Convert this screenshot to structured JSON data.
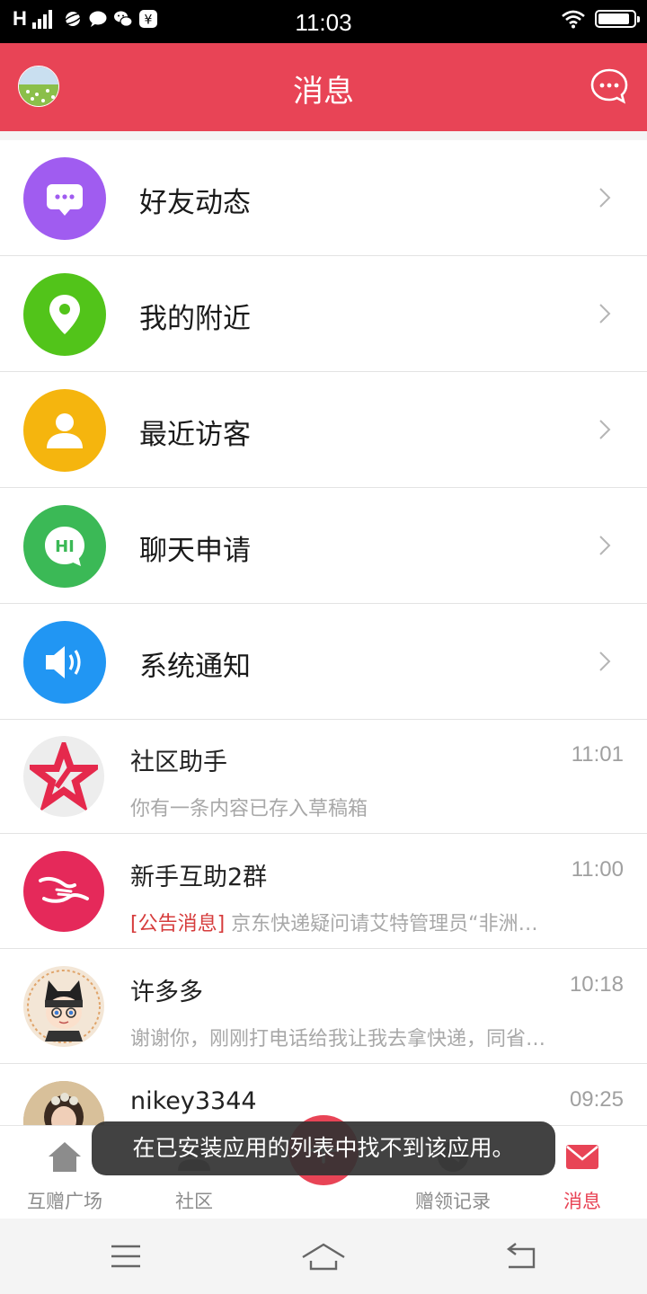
{
  "status_bar": {
    "carrier": "H",
    "time": "11:03"
  },
  "header": {
    "title": "消息"
  },
  "features": [
    {
      "label": "好友动态",
      "icon": "chat-dots-icon",
      "color": "#a05cf0"
    },
    {
      "label": "我的附近",
      "icon": "location-pin-icon",
      "color": "#52c41a"
    },
    {
      "label": "最近访客",
      "icon": "person-icon",
      "color": "#f5b50e"
    },
    {
      "label": "聊天申请",
      "icon": "hi-bubble-icon",
      "color": "#3bb956"
    },
    {
      "label": "系统通知",
      "icon": "speaker-icon",
      "color": "#2196f3"
    }
  ],
  "messages": [
    {
      "name": "社区助手",
      "time": "11:01",
      "tag": "",
      "preview": "你有一条内容已存入草稿箱",
      "avatar": "star-logo-icon"
    },
    {
      "name": "新手互助2群",
      "time": "11:00",
      "tag": "[公告消息]",
      "preview": " 京东快递疑问请艾特管理员“非洲…",
      "avatar": "handshake-icon"
    },
    {
      "name": "许多多",
      "time": "10:18",
      "tag": "",
      "preview": "谢谢你，刚刚打电话给我让我去拿快递，同省…",
      "avatar": "cartoon-girl-avatar"
    },
    {
      "name": "nikey3344",
      "time": "09:25",
      "tag": "",
      "preview": "",
      "avatar": "girl-photo-avatar"
    }
  ],
  "tabs": [
    {
      "label": "互赠广场",
      "icon": "house-icon"
    },
    {
      "label": "社区",
      "icon": "community-icon"
    },
    {
      "label": "",
      "icon": "plus-icon"
    },
    {
      "label": "赠领记录",
      "icon": "record-icon"
    },
    {
      "label": "消息",
      "icon": "envelope-icon"
    }
  ],
  "toast": {
    "text": "在已安装应用的列表中找不到该应用。"
  },
  "colors": {
    "accent": "#e84456",
    "tab_inactive": "#8c8c8c"
  }
}
